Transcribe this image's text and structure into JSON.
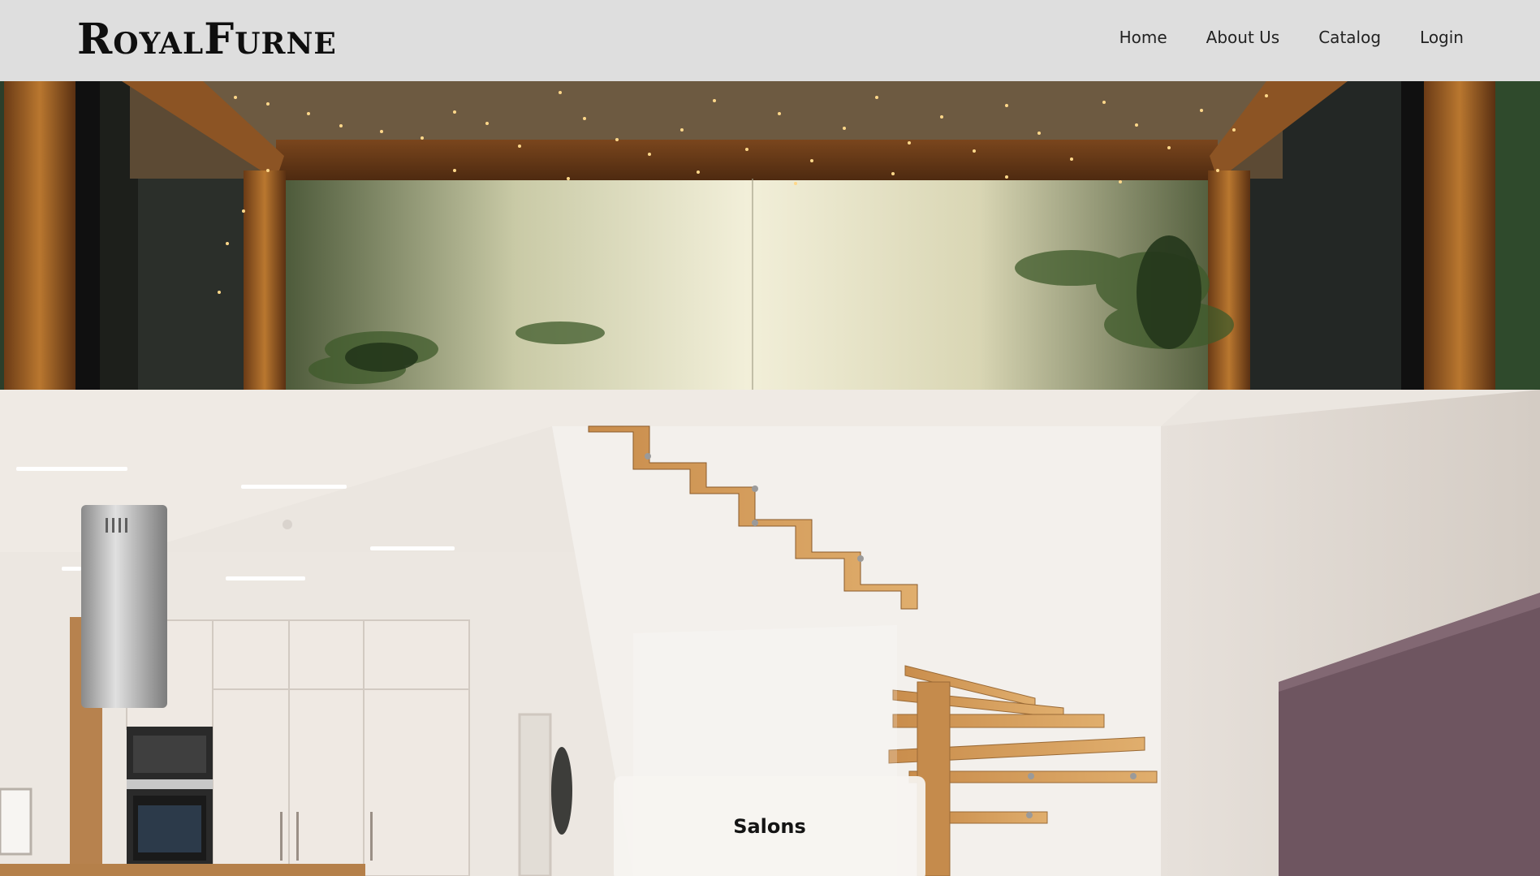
{
  "brand": {
    "logo_text": "RoyalFurne"
  },
  "nav": {
    "items": [
      {
        "label": "Home"
      },
      {
        "label": "About Us"
      },
      {
        "label": "Catalog"
      },
      {
        "label": "Login"
      }
    ]
  },
  "hero": {
    "images": [
      {
        "icon": "plant-wall-photo"
      },
      {
        "icon": "kitchen-stairs-photo"
      }
    ]
  },
  "categories": [
    {
      "title": "Salons"
    }
  ],
  "colors": {
    "header_bg": "#dedede",
    "text": "#0f0f0f",
    "wood": "#a8682e"
  }
}
